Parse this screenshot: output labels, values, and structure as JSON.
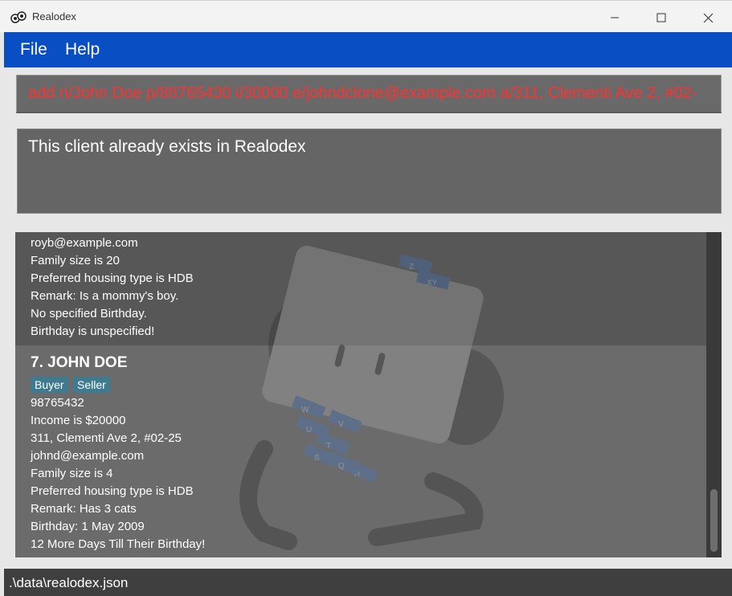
{
  "window": {
    "title": "Realodex"
  },
  "menu": {
    "file": "File",
    "help": "Help"
  },
  "command": {
    "value": "add n/John Doe p/88765430 i/30000 e/johndclone@example.com a/311, Clementi Ave 2, #02-"
  },
  "result": {
    "message": "This client already exists in Realodex"
  },
  "clients": [
    {
      "lines": [
        "royb@example.com",
        "Family size is 20",
        "Preferred housing type is HDB",
        "Remark: Is a mommy's boy.",
        "No specified Birthday.",
        "Birthday is unspecified!"
      ]
    },
    {
      "name": "7.  JOHN DOE",
      "tags": [
        "Buyer",
        "Seller"
      ],
      "lines": [
        "98765432",
        "Income is $20000",
        "311, Clementi Ave 2, #02-25",
        "johnd@example.com",
        "Family size is 4",
        "Preferred housing type is HDB",
        "Remark: Has 3 cats",
        "Birthday: 1 May 2009",
        "12 More Days Till Their Birthday!"
      ]
    }
  ],
  "watermark": {
    "letters": [
      "Z",
      "XY",
      "W",
      "V",
      "U",
      "T",
      "S",
      "R",
      "Q"
    ]
  },
  "status": {
    "path": ".\\data\\realodex.json"
  }
}
